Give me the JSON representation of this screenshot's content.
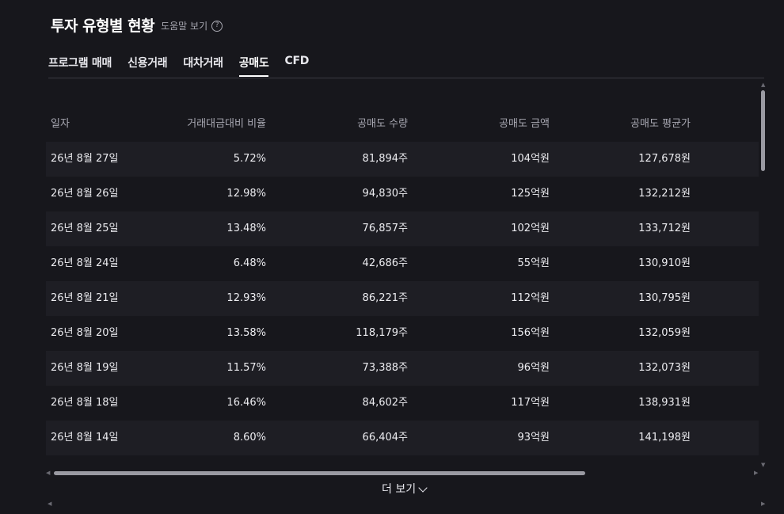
{
  "header": {
    "title": "투자 유형별 현황",
    "help_label": "도움말 보기",
    "help_icon": "question-circle-icon"
  },
  "tabs": [
    {
      "label": "프로그램 매매",
      "active": false
    },
    {
      "label": "신용거래",
      "active": false
    },
    {
      "label": "대차거래",
      "active": false
    },
    {
      "label": "공매도",
      "active": true
    },
    {
      "label": "CFD",
      "active": false
    }
  ],
  "table": {
    "columns": [
      "일자",
      "거래대금대비 비율",
      "공매도 수량",
      "공매도 금액",
      "공매도 평균가"
    ],
    "rows": [
      {
        "date": "26년 8월 27일",
        "ratio": "5.72%",
        "qty": "81,894주",
        "amount": "104억원",
        "avg": "127,678원"
      },
      {
        "date": "26년 8월 26일",
        "ratio": "12.98%",
        "qty": "94,830주",
        "amount": "125억원",
        "avg": "132,212원"
      },
      {
        "date": "26년 8월 25일",
        "ratio": "13.48%",
        "qty": "76,857주",
        "amount": "102억원",
        "avg": "133,712원"
      },
      {
        "date": "26년 8월 24일",
        "ratio": "6.48%",
        "qty": "42,686주",
        "amount": "55억원",
        "avg": "130,910원"
      },
      {
        "date": "26년 8월 21일",
        "ratio": "12.93%",
        "qty": "86,221주",
        "amount": "112억원",
        "avg": "130,795원"
      },
      {
        "date": "26년 8월 20일",
        "ratio": "13.58%",
        "qty": "118,179주",
        "amount": "156억원",
        "avg": "132,059원"
      },
      {
        "date": "26년 8월 19일",
        "ratio": "11.57%",
        "qty": "73,388주",
        "amount": "96억원",
        "avg": "132,073원"
      },
      {
        "date": "26년 8월 18일",
        "ratio": "16.46%",
        "qty": "84,602주",
        "amount": "117억원",
        "avg": "138,931원"
      },
      {
        "date": "26년 8월 14일",
        "ratio": "8.60%",
        "qty": "66,404주",
        "amount": "93억원",
        "avg": "141,198원"
      }
    ]
  },
  "more_button": {
    "label": "더 보기",
    "icon": "chevron-down-icon"
  },
  "colors": {
    "background": "#17171c",
    "row_shade": "#1e1e24",
    "text": "#ececf0",
    "muted": "#a8a8b2"
  }
}
